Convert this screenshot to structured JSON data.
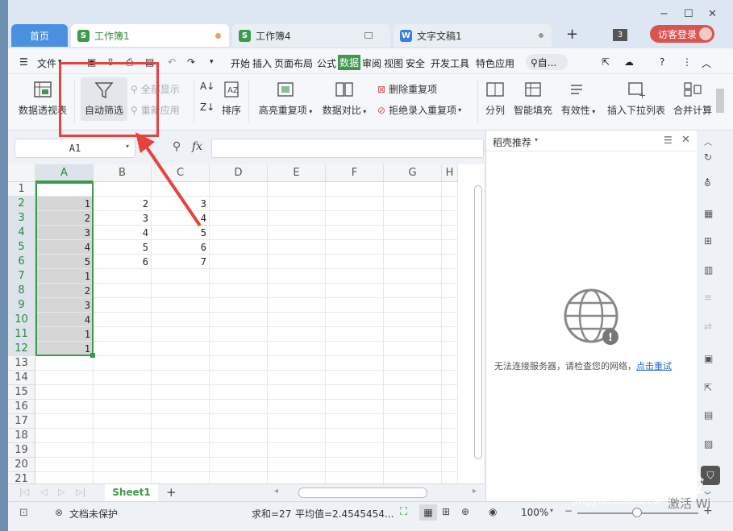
{
  "window": {
    "minimize": "−",
    "maximize": "☐",
    "close": "✕",
    "restore": "◻"
  },
  "tabs": [
    {
      "label": "首页"
    },
    {
      "label": "工作簿1",
      "icon": "S"
    },
    {
      "label": "工作簿4",
      "icon": "S"
    },
    {
      "label": "文字文稿1",
      "icon": "W"
    }
  ],
  "tab_count": "3",
  "login": "访客登录",
  "menu": {
    "file": "文件",
    "items": [
      "开始",
      "插入",
      "页面布局",
      "公式",
      "数据",
      "审阅",
      "视图",
      "安全",
      "开发工具",
      "特色应用"
    ],
    "active": "数据",
    "search": "自..."
  },
  "ribbon": {
    "pivot": "数据透视表",
    "autofilter": "自动筛选",
    "show_all": "全部显示",
    "reapply": "重新应用",
    "sort": "排序",
    "highlight_dup": "高亮重复项",
    "compare": "数据对比",
    "delete_dup": "删除重复项",
    "reject_dup": "拒绝录入重复项",
    "split": "分列",
    "smart_fill": "智能填充",
    "validity": "有效性",
    "dropdown": "插入下拉列表",
    "merge_calc": "合并计算"
  },
  "formula": {
    "namebox": "A1",
    "fx": "fx"
  },
  "columns": [
    "A",
    "B",
    "C",
    "D",
    "E",
    "F",
    "G",
    "H"
  ],
  "rows": [
    "1",
    "2",
    "3",
    "4",
    "5",
    "6",
    "7",
    "8",
    "9",
    "10",
    "11",
    "12",
    "13",
    "14",
    "15",
    "16",
    "17",
    "18",
    "19",
    "20",
    "21"
  ],
  "cells": {
    "A": [
      "",
      "1",
      "2",
      "3",
      "4",
      "5",
      "1",
      "2",
      "3",
      "4",
      "1",
      "1"
    ],
    "B": [
      "",
      "2",
      "3",
      "4",
      "5",
      "6"
    ],
    "C": [
      "",
      "3",
      "4",
      "5",
      "6",
      "7"
    ]
  },
  "sheet": {
    "name": "Sheet1",
    "add": "+"
  },
  "status": {
    "protect": "文档未保护",
    "sum": "求和=27",
    "avg": "平均值=2.4545454...",
    "zoom": "100%"
  },
  "panel": {
    "title": "稻壳推荐",
    "message": "无法连接服务器，请检查您的网络，",
    "retry": "点击重试"
  },
  "watermark": {
    "brand": "Bai du 经验",
    "url": "jingyan.baidu.com",
    "activate": "激活 Wi"
  },
  "colors": {
    "accent": "#3c9a4c",
    "annotation": "#e8423f",
    "login": "#d9534f"
  }
}
